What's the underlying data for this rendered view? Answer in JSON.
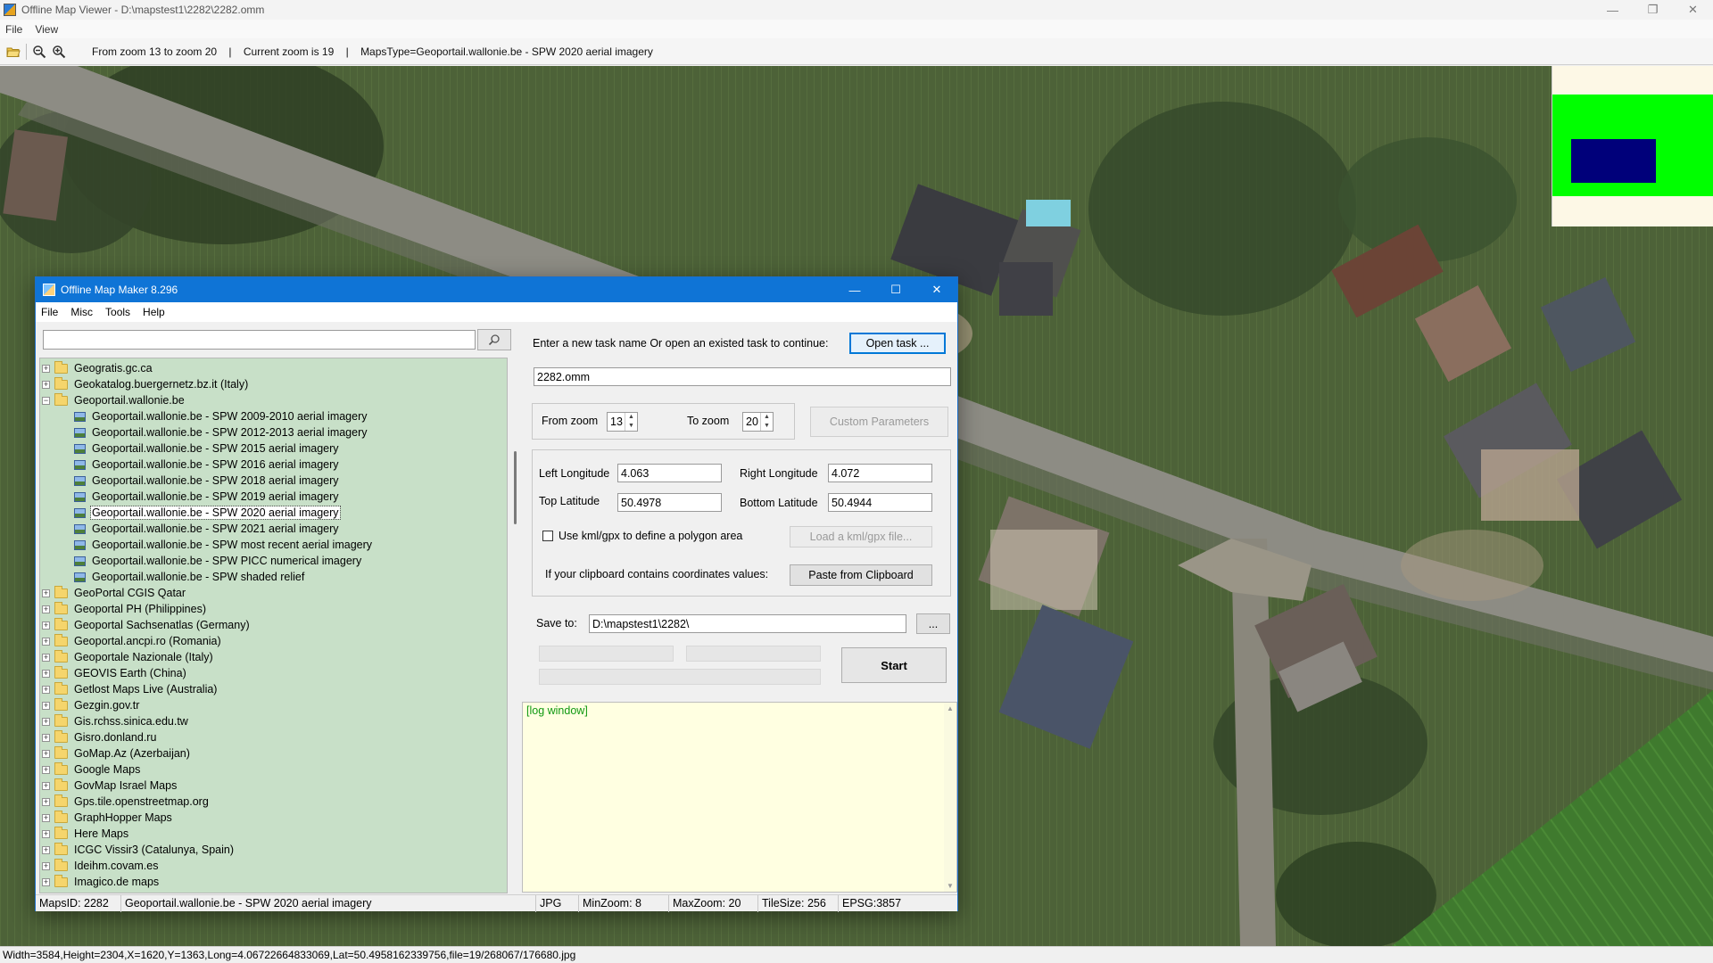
{
  "viewer": {
    "title": "Offline Map Viewer - D:\\mapstest1\\2282\\2282.omm",
    "menu": [
      "File",
      "View"
    ],
    "toolbar": {
      "zoom_range": "From zoom 13 to zoom 20",
      "current_zoom": "Current zoom is 19",
      "maps_type": "MapsType=Geoportail.wallonie.be - SPW 2020 aerial imagery",
      "sep": "|"
    },
    "statusbar": "Width=3584,Height=2304,X=1620,Y=1363,Long=4.06722664833069,Lat=50.4958162339756,file=19/268067/176680.jpg",
    "window_controls": [
      "—",
      "❐",
      "✕"
    ]
  },
  "maker": {
    "title": "Offline Map Maker 8.296",
    "menu": [
      "File",
      "Misc",
      "Tools",
      "Help"
    ],
    "window_controls": [
      "—",
      "☐",
      "✕"
    ],
    "search": {
      "value": "",
      "icon": "search-icon"
    },
    "tree": [
      {
        "label": "Geogratis.gc.ca",
        "type": "folder",
        "expanded": false
      },
      {
        "label": "Geokatalog.buergernetz.bz.it (Italy)",
        "type": "folder",
        "expanded": false
      },
      {
        "label": "Geoportail.wallonie.be",
        "type": "folder",
        "expanded": true
      },
      {
        "label": "Geoportail.wallonie.be - SPW 2009-2010 aerial imagery",
        "type": "map"
      },
      {
        "label": "Geoportail.wallonie.be - SPW 2012-2013 aerial imagery",
        "type": "map"
      },
      {
        "label": "Geoportail.wallonie.be - SPW 2015 aerial imagery",
        "type": "map"
      },
      {
        "label": "Geoportail.wallonie.be - SPW 2016 aerial imagery",
        "type": "map"
      },
      {
        "label": "Geoportail.wallonie.be - SPW 2018 aerial imagery",
        "type": "map"
      },
      {
        "label": "Geoportail.wallonie.be - SPW 2019 aerial imagery",
        "type": "map"
      },
      {
        "label": "Geoportail.wallonie.be - SPW 2020 aerial imagery",
        "type": "map",
        "selected": true
      },
      {
        "label": "Geoportail.wallonie.be - SPW 2021 aerial imagery",
        "type": "map"
      },
      {
        "label": "Geoportail.wallonie.be - SPW most recent aerial imagery",
        "type": "map"
      },
      {
        "label": "Geoportail.wallonie.be - SPW PICC numerical imagery",
        "type": "map"
      },
      {
        "label": "Geoportail.wallonie.be - SPW shaded relief",
        "type": "map"
      },
      {
        "label": "GeoPortal CGIS Qatar",
        "type": "folder",
        "expanded": false
      },
      {
        "label": "Geoportal PH (Philippines)",
        "type": "folder",
        "expanded": false
      },
      {
        "label": "Geoportal Sachsenatlas (Germany)",
        "type": "folder",
        "expanded": false
      },
      {
        "label": "Geoportal.ancpi.ro (Romania)",
        "type": "folder",
        "expanded": false
      },
      {
        "label": "Geoportale Nazionale (Italy)",
        "type": "folder",
        "expanded": false
      },
      {
        "label": "GEOVIS Earth (China)",
        "type": "folder",
        "expanded": false
      },
      {
        "label": "Getlost Maps Live (Australia)",
        "type": "folder",
        "expanded": false
      },
      {
        "label": "Gezgin.gov.tr",
        "type": "folder",
        "expanded": false
      },
      {
        "label": "Gis.rchss.sinica.edu.tw",
        "type": "folder",
        "expanded": false
      },
      {
        "label": "Gisro.donland.ru",
        "type": "folder",
        "expanded": false
      },
      {
        "label": "GoMap.Az (Azerbaijan)",
        "type": "folder",
        "expanded": false
      },
      {
        "label": "Google Maps",
        "type": "folder",
        "expanded": false
      },
      {
        "label": "GovMap Israel Maps",
        "type": "folder",
        "expanded": false
      },
      {
        "label": "Gps.tile.openstreetmap.org",
        "type": "folder",
        "expanded": false
      },
      {
        "label": "GraphHopper Maps",
        "type": "folder",
        "expanded": false
      },
      {
        "label": "Here Maps",
        "type": "folder",
        "expanded": false
      },
      {
        "label": "ICGC Vissir3 (Catalunya, Spain)",
        "type": "folder",
        "expanded": false
      },
      {
        "label": "Ideihm.covam.es",
        "type": "folder",
        "expanded": false
      },
      {
        "label": "Imagico.de maps",
        "type": "folder",
        "expanded": false
      }
    ],
    "task": {
      "prompt": "Enter a new task name Or open an existed task to continue:",
      "open_label": "Open task ...",
      "name_value": "2282.omm"
    },
    "zoom": {
      "from_label": "From zoom",
      "from_value": "13",
      "to_label": "To zoom",
      "to_value": "20",
      "custom_label": "Custom Parameters"
    },
    "coords": {
      "left_lon_label": "Left Longitude",
      "left_lon_value": "4.063",
      "right_lon_label": "Right Longitude",
      "right_lon_value": "4.072",
      "top_lat_label": "Top Latitude",
      "top_lat_value": "50.4978",
      "bottom_lat_label": "Bottom Latitude",
      "bottom_lat_value": "50.4944",
      "kml_label": "Use kml/gpx to define a polygon area",
      "kml_checked": false,
      "load_kml_label": "Load a kml/gpx file...",
      "clipboard_prompt": "If your clipboard contains coordinates values:",
      "paste_label": "Paste from Clipboard"
    },
    "save": {
      "label": "Save to:",
      "value": "D:\\mapstest1\\2282\\",
      "browse_label": "..."
    },
    "start_label": "Start",
    "log_text": "[log window]",
    "status": {
      "maps_id": "MapsID: 2282",
      "maps_name": "Geoportail.wallonie.be - SPW 2020 aerial imagery",
      "format": "JPG",
      "min_zoom": "MinZoom: 8",
      "max_zoom": "MaxZoom: 20",
      "tile_size": "TileSize: 256",
      "epsg": "EPSG:3857"
    }
  },
  "colors": {
    "maker_title_bg": "#0f74d6",
    "tree_bg": "#c8e0c8",
    "log_bg": "#ffffe1",
    "log_text": "#119911",
    "minimap_area": "#00ff00",
    "minimap_view": "#00007a"
  }
}
